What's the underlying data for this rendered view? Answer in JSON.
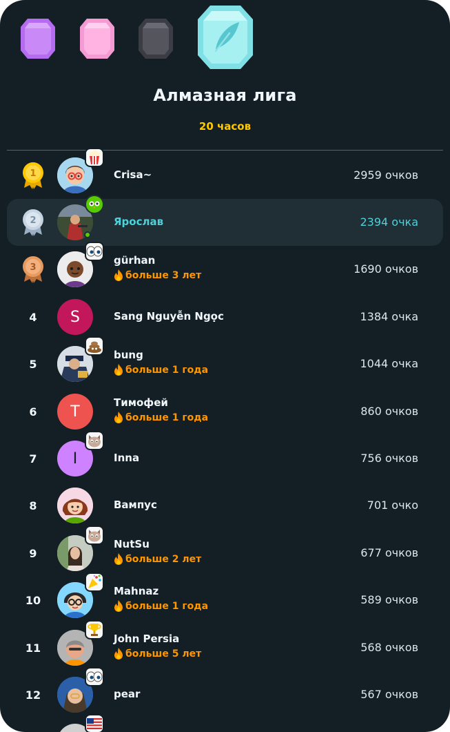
{
  "league": {
    "title": "Алмазная лига",
    "timer": "20 часов",
    "badges": [
      "amethyst-league-icon",
      "pearl-league-icon",
      "obsidian-league-icon",
      "diamond-league-icon"
    ]
  },
  "colors": {
    "background": "#131f24",
    "highlight_row": "#202f36",
    "accent_teal": "#4fd1d9",
    "streak_orange": "#ff9600",
    "timer_yellow": "#ffc800"
  },
  "leaderboard": [
    {
      "rank": "1",
      "name": "Crisa~",
      "streak": "",
      "points": "2959 очков"
    },
    {
      "rank": "2",
      "name": "Ярослав",
      "streak": "",
      "points": "2394 очка"
    },
    {
      "rank": "3",
      "name": "gürhan",
      "streak": "больше 3 лет",
      "points": "1690 очков"
    },
    {
      "rank": "4",
      "name": "Sang Nguyễn Ngọc",
      "streak": "",
      "points": "1384 очка",
      "initial": "S"
    },
    {
      "rank": "5",
      "name": "bung",
      "streak": "больше 1 года",
      "points": "1044 очка"
    },
    {
      "rank": "6",
      "name": "Тимофей",
      "streak": "больше 1 года",
      "points": "860 очков",
      "initial": "Т"
    },
    {
      "rank": "7",
      "name": "Inna",
      "streak": "",
      "points": "756 очков",
      "initial": "I"
    },
    {
      "rank": "8",
      "name": "Вампус",
      "streak": "",
      "points": "701 очко"
    },
    {
      "rank": "9",
      "name": "NutSu",
      "streak": "больше 2 лет",
      "points": "677 очков"
    },
    {
      "rank": "10",
      "name": "Mahnaz",
      "streak": "больше 1 года",
      "points": "589 очков"
    },
    {
      "rank": "11",
      "name": "John Persia",
      "streak": "больше 5 лет",
      "points": "568 очков"
    },
    {
      "rank": "12",
      "name": "pear",
      "streak": "",
      "points": "567 очков"
    }
  ]
}
